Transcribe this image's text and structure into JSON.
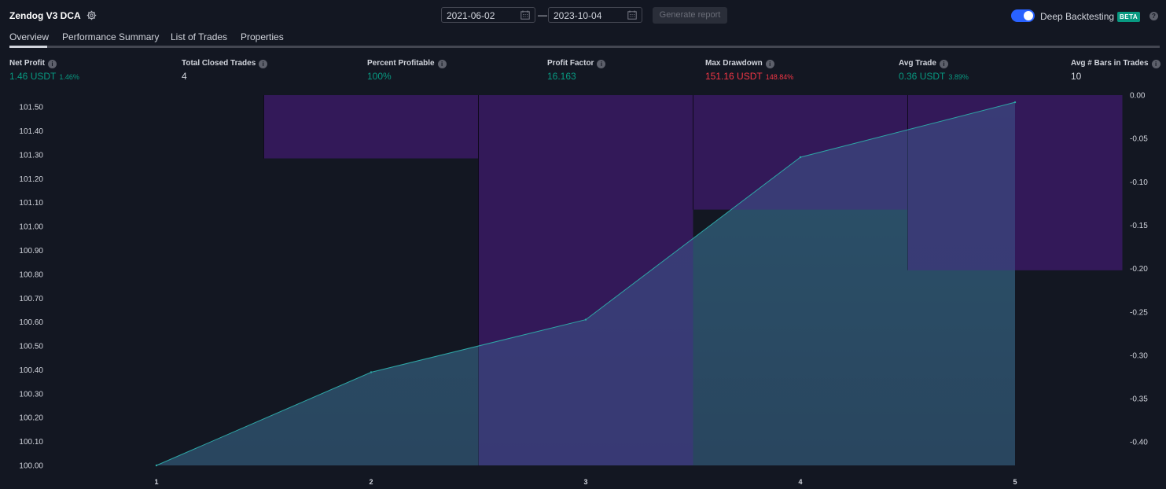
{
  "header": {
    "title": "Zendog V3 DCA",
    "date_from": "2021-06-02",
    "date_to": "2023-10-04",
    "date_separator": "—",
    "generate_label": "Generate report",
    "deep_backtesting_label": "Deep Backtesting",
    "deep_backtesting_on": true,
    "beta_label": "BETA",
    "help_label": "?"
  },
  "tabs": [
    {
      "label": "Overview",
      "active": true
    },
    {
      "label": "Performance Summary",
      "active": false
    },
    {
      "label": "List of Trades",
      "active": false
    },
    {
      "label": "Properties",
      "active": false
    }
  ],
  "metrics": [
    {
      "label": "Net Profit",
      "value": "1.46 USDT",
      "pct": "1.46%",
      "color": "#089981"
    },
    {
      "label": "Total Closed Trades",
      "value": "4",
      "pct": "",
      "color": "#d1d4dc"
    },
    {
      "label": "Percent Profitable",
      "value": "100%",
      "pct": "",
      "color": "#089981"
    },
    {
      "label": "Profit Factor",
      "value": "16.163",
      "pct": "",
      "color": "#089981"
    },
    {
      "label": "Max Drawdown",
      "value": "151.16 USDT",
      "pct": "148.84%",
      "color": "#f23645"
    },
    {
      "label": "Avg Trade",
      "value": "0.36 USDT",
      "pct": "3.89%",
      "color": "#089981"
    },
    {
      "label": "Avg # Bars in Trades",
      "value": "10",
      "pct": "",
      "color": "#d1d4dc"
    }
  ],
  "chart_data": {
    "type": "line",
    "x": [
      1,
      2,
      3,
      4,
      5
    ],
    "equity": {
      "values": [
        100.0,
        100.39,
        100.61,
        101.29,
        101.52
      ],
      "line_color": "#2ea6a6"
    },
    "drawdown_bars": {
      "values": [
        -0.073,
        -0.427,
        -0.132,
        -0.202
      ],
      "color": "#3a1a63"
    },
    "left_axis": {
      "ticks": [
        "100.00",
        "100.10",
        "100.20",
        "100.30",
        "100.40",
        "100.50",
        "100.60",
        "100.70",
        "100.80",
        "100.90",
        "101.00",
        "101.10",
        "101.20",
        "101.30",
        "101.40",
        "101.50"
      ],
      "ylim": [
        100.0,
        101.55
      ]
    },
    "right_axis": {
      "ticks": [
        "0.00",
        "-0.05",
        "-0.10",
        "-0.15",
        "-0.20",
        "-0.25",
        "-0.30",
        "-0.35",
        "-0.40"
      ],
      "ylim": [
        -0.427,
        0.0
      ]
    },
    "x_ticks": [
      "1",
      "2",
      "3",
      "4",
      "5"
    ]
  }
}
